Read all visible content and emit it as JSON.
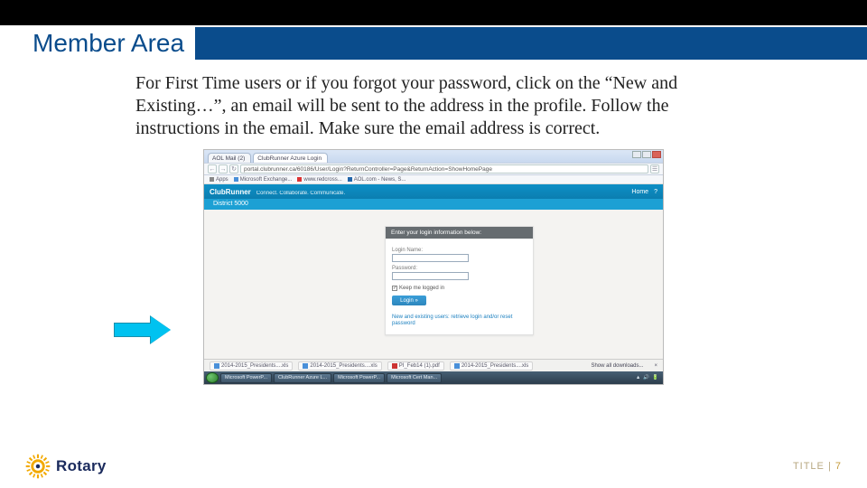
{
  "slide": {
    "title": "Member Area",
    "body": "For First Time users or if you forgot your password, click on the “New and Existing…”, an email will be sent to the address in the profile. Follow the instructions in the email. Make sure the email address is correct."
  },
  "browser": {
    "tab1": "AOL Mail (2)",
    "tab2": "ClubRunner Azure Login",
    "url": "portal.clubrunner.ca/60186/User/Login?ReturnController=Page&ReturnAction=ShowHomePage",
    "bookmarks": {
      "apps": "Apps",
      "b1": "Microsoft Exchange...",
      "b2": "www.redcross...",
      "b3": "AOL.com - News, S..."
    }
  },
  "clubrunner": {
    "brand": "ClubRunner",
    "tagline": "Connect. Collaborate. Communicate.",
    "home": "Home",
    "help": "?",
    "band": "District 5000"
  },
  "login": {
    "header": "Enter your login information below:",
    "login_name_label": "Login Name:",
    "password_label": "Password:",
    "keep_label": "Keep me logged in",
    "button": "Login »",
    "link": "New and existing users: retrieve login and/or reset password"
  },
  "downloads": {
    "d1": "2014-2015_Presidents....xls",
    "d2": "2014-2015_Presidents....xls",
    "d3": "PI_Feb14 (1).pdf",
    "d4": "2014-2015_Presidents....xls",
    "showall": "Show all downloads...",
    "close": "×"
  },
  "taskbar": {
    "t1": "Microsoft PowerP...",
    "t2": "ClubRunner Azure L...",
    "t3": "Microsoft PowerP...",
    "t4": "Microsoft Cert Man..."
  },
  "footer": {
    "brand": "Rotary",
    "pager_label": "TITLE",
    "pager_sep": "|",
    "pager_num": "7"
  }
}
